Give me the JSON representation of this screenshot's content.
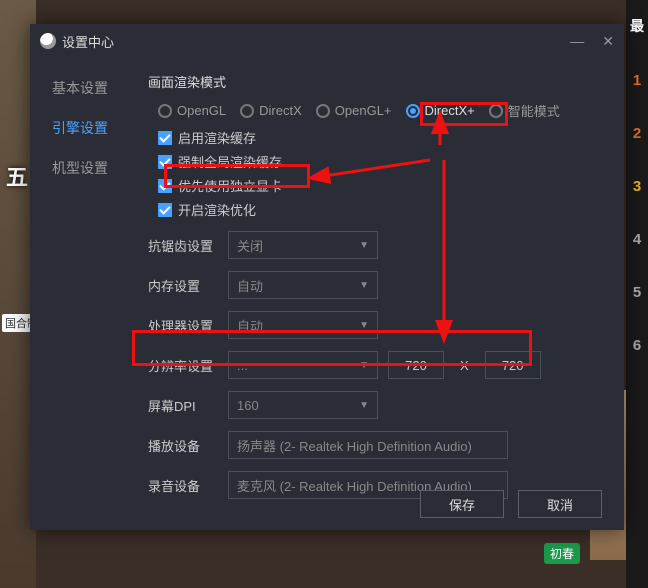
{
  "window": {
    "title": "设置中心",
    "minimize": "—",
    "close": "✕"
  },
  "sidebar": {
    "items": [
      {
        "label": "基本设置"
      },
      {
        "label": "引擎设置"
      },
      {
        "label": "机型设置"
      }
    ]
  },
  "render_mode": {
    "title": "画面渲染模式",
    "options": [
      "OpenGL",
      "DirectX",
      "OpenGL+",
      "DirectX+",
      "智能模式"
    ],
    "selected": "DirectX+",
    "checkboxes": [
      {
        "label": "启用渲染缓存",
        "checked": true
      },
      {
        "label": "强制全局渲染缓存",
        "checked": true
      },
      {
        "label": "优先使用独立显卡",
        "checked": true
      },
      {
        "label": "开启渲染优化",
        "checked": true
      }
    ]
  },
  "antialias": {
    "label": "抗锯齿设置",
    "value": "关闭"
  },
  "memory": {
    "label": "内存设置",
    "value": "自动"
  },
  "cpu": {
    "label": "处理器设置",
    "value": "自动"
  },
  "resolution": {
    "label": "分辨率设置",
    "value": "...",
    "w": "720",
    "sep": "X",
    "h": "720"
  },
  "dpi": {
    "label": "屏幕DPI",
    "value": "160"
  },
  "playback": {
    "label": "播放设备",
    "value": "扬声器 (2- Realtek High Definition Audio)"
  },
  "record": {
    "label": "录音设备",
    "value": "麦克风 (2- Realtek High Definition Audio)"
  },
  "footer": {
    "save": "保存",
    "cancel": "取消"
  },
  "bg": {
    "leftchar1": "五",
    "mini_label": "国合制",
    "ranks": [
      "最",
      "1",
      "2",
      "3",
      "4",
      "5",
      "6"
    ],
    "tag": "初春"
  }
}
